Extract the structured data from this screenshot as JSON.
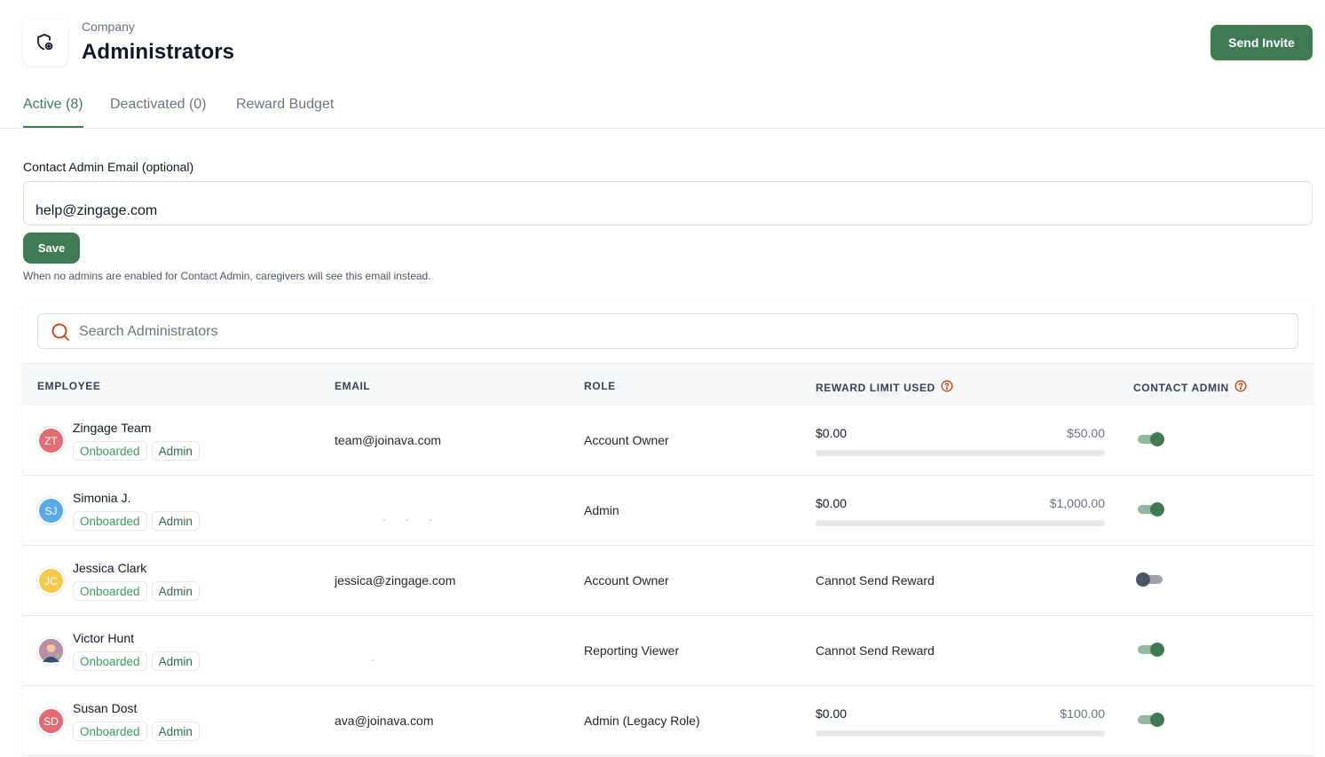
{
  "header": {
    "breadcrumb": "Company",
    "title": "Administrators",
    "send_invite_label": "Send Invite",
    "logo_icon": "shield-gear-icon"
  },
  "tabs": [
    {
      "label": "Active (8)",
      "active": true
    },
    {
      "label": "Deactivated (0)",
      "active": false
    },
    {
      "label": "Reward Budget",
      "active": false
    }
  ],
  "contact_admin": {
    "label": "Contact Admin Email (optional)",
    "value": "help@zingage.com",
    "save_label": "Save",
    "hint": "When no admins are enabled for Contact Admin, caregivers will see this email instead."
  },
  "search": {
    "placeholder": "Search Administrators",
    "icon": "search-icon"
  },
  "table": {
    "columns": [
      "EMPLOYEE",
      "EMAIL",
      "ROLE",
      "REWARD LIMIT USED",
      "CONTACT ADMIN"
    ],
    "rows": [
      {
        "initials": "ZT",
        "avatar_color": "#e06c75",
        "name": "Zingage Team",
        "badges": [
          "Onboarded",
          "Admin"
        ],
        "email": "team@joinava.com",
        "role": "Account Owner",
        "reward_used": "$0.00",
        "reward_limit": "$50.00",
        "progress": 0,
        "reward_text": "",
        "contact_admin": true
      },
      {
        "initials": "SJ",
        "avatar_color": "#5aa9e6",
        "name": "Simonia J.",
        "badges": [
          "Onboarded",
          "Admin"
        ],
        "email": "",
        "role": "Admin",
        "reward_used": "$0.00",
        "reward_limit": "$1,000.00",
        "progress": 0,
        "reward_text": "",
        "contact_admin": true
      },
      {
        "initials": "JC",
        "avatar_color": "#f2c94c",
        "name": "Jessica Clark",
        "badges": [
          "Onboarded",
          "Admin"
        ],
        "email": "jessica@zingage.com",
        "role": "Account Owner",
        "reward_used": "",
        "reward_limit": "",
        "progress": null,
        "reward_text": "Cannot Send Reward",
        "contact_admin": false
      },
      {
        "initials": "",
        "avatar_color": "#7a5c8a",
        "name": "Victor Hunt",
        "badges": [
          "Onboarded",
          "Admin"
        ],
        "email": "",
        "role": "Reporting Viewer",
        "reward_used": "",
        "reward_limit": "",
        "progress": null,
        "reward_text": "Cannot Send Reward",
        "contact_admin": true
      },
      {
        "initials": "SD",
        "avatar_color": "#e06c75",
        "name": "Susan Dost",
        "badges": [
          "Onboarded",
          "Admin"
        ],
        "email": "ava@joinava.com",
        "role": "Admin (Legacy Role)",
        "reward_used": "$0.00",
        "reward_limit": "$100.00",
        "progress": 0,
        "reward_text": "",
        "contact_admin": true
      }
    ]
  },
  "colors": {
    "accent": "#3f7a55",
    "help_icon": "#c2410c"
  }
}
